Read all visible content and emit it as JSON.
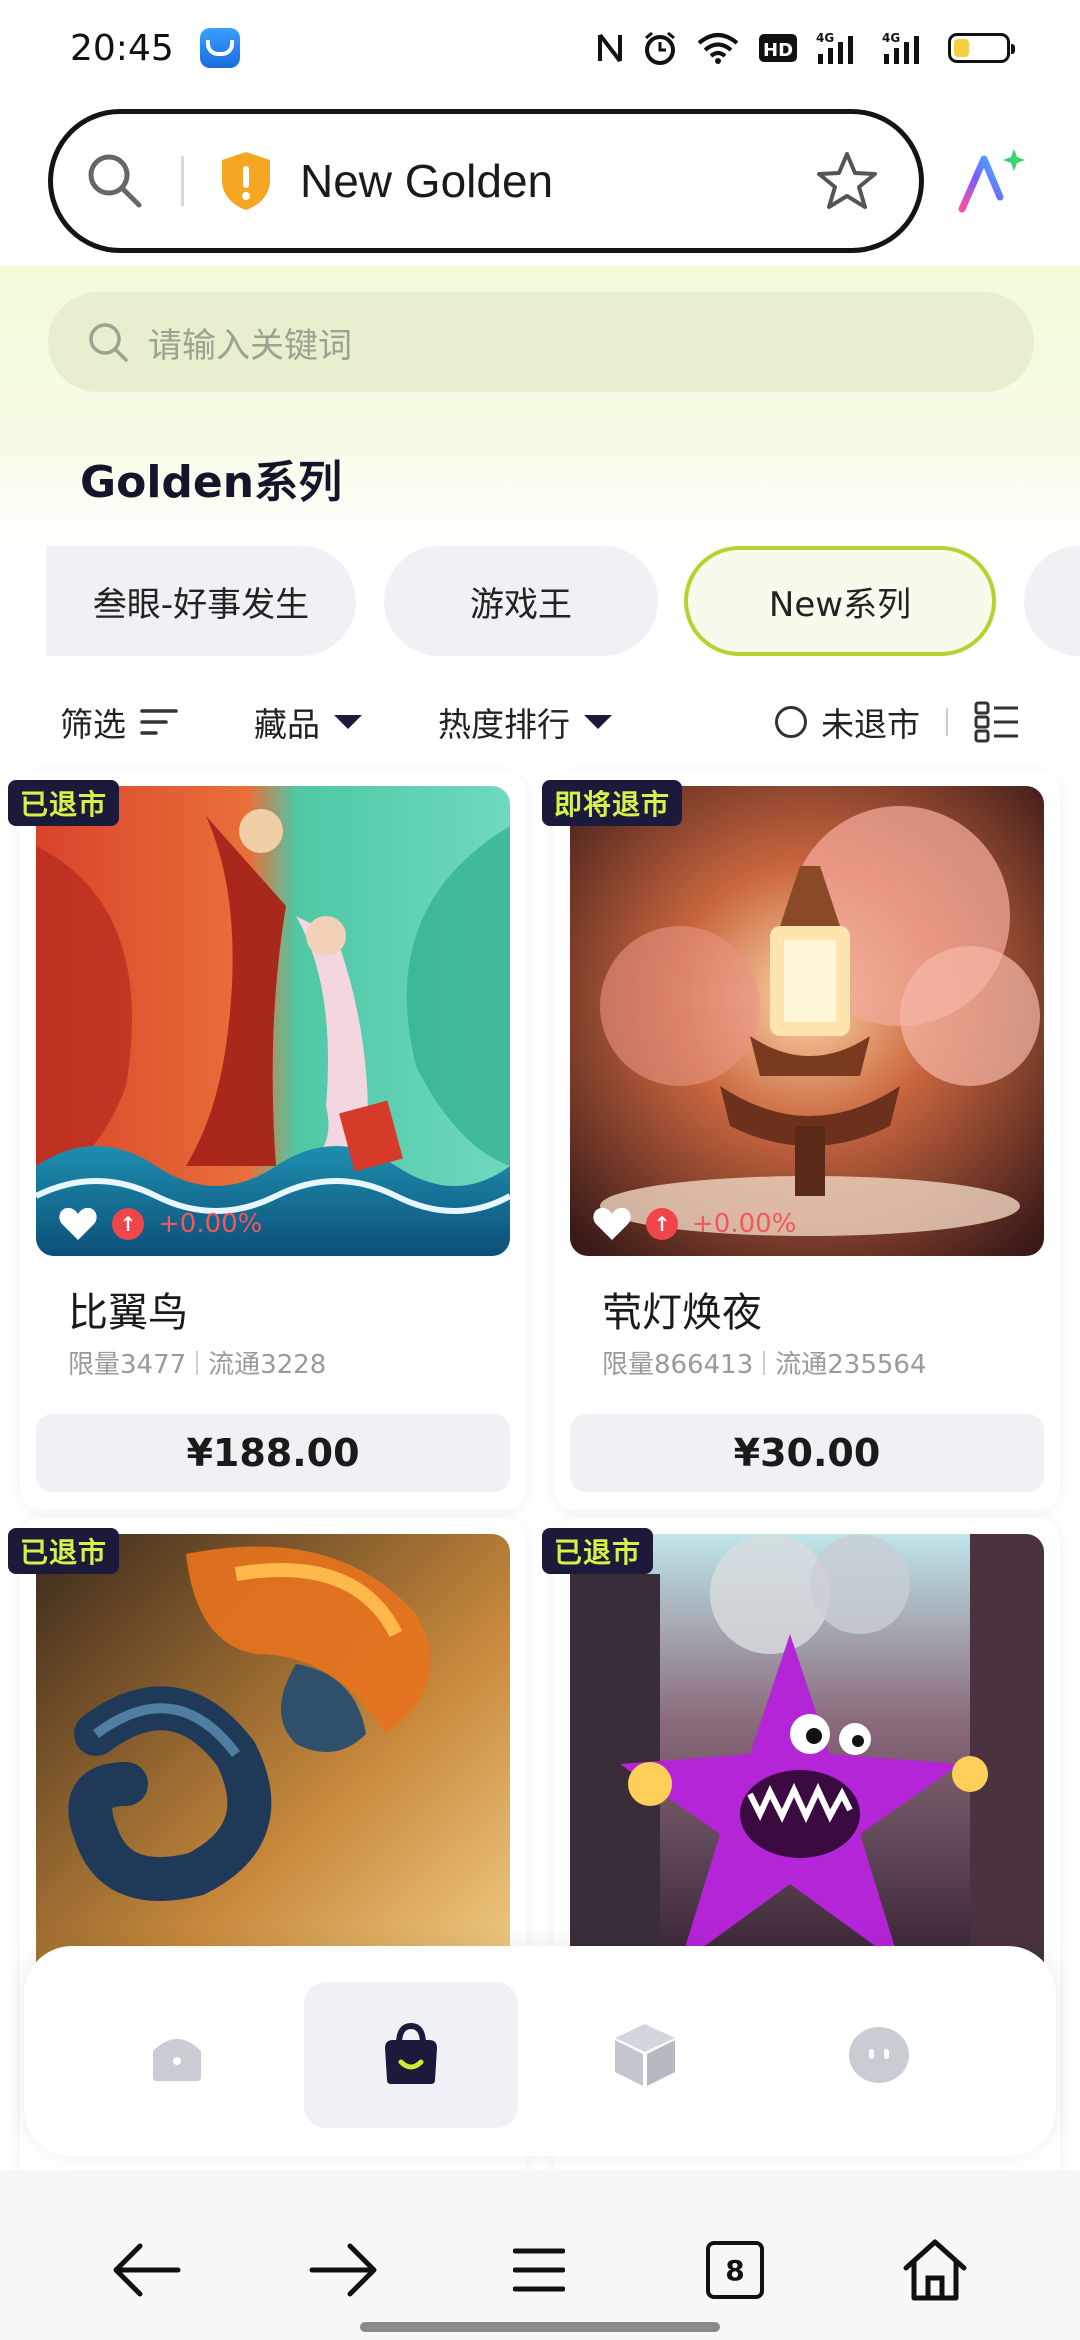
{
  "status_bar": {
    "time": "20:45",
    "battery_level": 0.3
  },
  "browser": {
    "url_title": "New Golden",
    "tab_count": "8"
  },
  "search": {
    "placeholder": "请输入关键词"
  },
  "series_title": "Golden系列",
  "tabs": [
    {
      "label": "叁眼-好事发生",
      "active": false
    },
    {
      "label": "游戏王",
      "active": false
    },
    {
      "label": "New系列",
      "active": true
    },
    {
      "label": "",
      "active": false
    }
  ],
  "filters": {
    "filter_label": "筛选",
    "collection_label": "藏品",
    "sort_label": "热度排行",
    "radio_label": "未退市"
  },
  "products": [
    {
      "badge": "已退市",
      "change": "+0.00%",
      "name": "比翼鸟",
      "limit": "限量3477",
      "circulation": "流通3228",
      "price": "¥188.00"
    },
    {
      "badge": "即将退市",
      "change": "+0.00%",
      "name": "茕灯焕夜",
      "limit": "限量866413",
      "circulation": "流通235564",
      "price": "¥30.00"
    },
    {
      "badge": "已退市",
      "change": "",
      "name": "",
      "limit": "",
      "circulation": "",
      "price": ""
    },
    {
      "badge": "已退市",
      "change": "",
      "name": "",
      "limit": "",
      "circulation": "",
      "price": ""
    }
  ],
  "colors": {
    "accent": "#b5d22f",
    "badge_bg": "#1c1a3a",
    "badge_text": "#d6f24a",
    "up": "#f1454c"
  },
  "app_nav": [
    {
      "icon": "home-icon",
      "active": false
    },
    {
      "icon": "shopping-bag-icon",
      "active": true
    },
    {
      "icon": "box-icon",
      "active": false
    },
    {
      "icon": "chat-face-icon",
      "active": false
    }
  ],
  "browser_nav": [
    "back-arrow-icon",
    "forward-arrow-icon",
    "menu-icon",
    "tabs-icon",
    "home-icon"
  ]
}
